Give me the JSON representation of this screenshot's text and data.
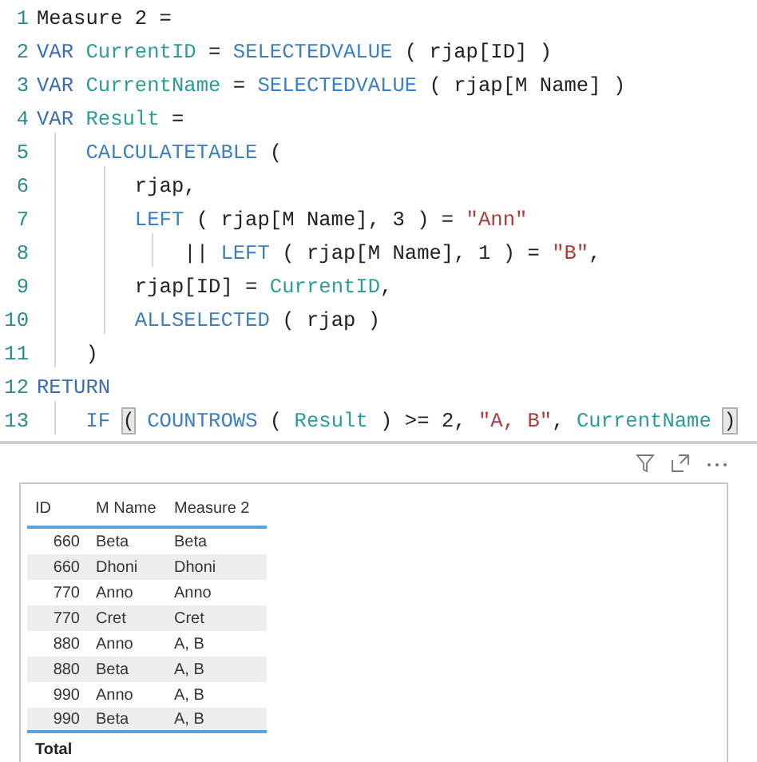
{
  "code_editor": {
    "lines": [
      {
        "number": "1",
        "tokens": [
          {
            "kind": "plain",
            "text": "Measure 2 ="
          }
        ]
      },
      {
        "number": "2",
        "tokens": [
          {
            "kind": "keyword",
            "text": "VAR "
          },
          {
            "kind": "variable",
            "text": "CurrentID"
          },
          {
            "kind": "plain",
            "text": " = "
          },
          {
            "kind": "function",
            "text": "SELECTEDVALUE"
          },
          {
            "kind": "plain",
            "text": " ( rjap[ID] )"
          }
        ]
      },
      {
        "number": "3",
        "tokens": [
          {
            "kind": "keyword",
            "text": "VAR "
          },
          {
            "kind": "variable",
            "text": "CurrentName"
          },
          {
            "kind": "plain",
            "text": " = "
          },
          {
            "kind": "function",
            "text": "SELECTEDVALUE"
          },
          {
            "kind": "plain",
            "text": " ( rjap[M Name] )"
          }
        ]
      },
      {
        "number": "4",
        "tokens": [
          {
            "kind": "keyword",
            "text": "VAR "
          },
          {
            "kind": "variable",
            "text": "Result"
          },
          {
            "kind": "plain",
            "text": " ="
          }
        ]
      },
      {
        "number": "5",
        "tokens": [
          {
            "kind": "function",
            "text": "    CALCULATETABLE"
          },
          {
            "kind": "plain",
            "text": " ("
          }
        ]
      },
      {
        "number": "6",
        "tokens": [
          {
            "kind": "plain",
            "text": "        rjap,"
          }
        ]
      },
      {
        "number": "7",
        "tokens": [
          {
            "kind": "function",
            "text": "        LEFT"
          },
          {
            "kind": "plain",
            "text": " ( rjap[M Name], 3 ) = "
          },
          {
            "kind": "string",
            "text": "\"Ann\""
          }
        ]
      },
      {
        "number": "8",
        "tokens": [
          {
            "kind": "plain",
            "text": "            || "
          },
          {
            "kind": "function",
            "text": "LEFT"
          },
          {
            "kind": "plain",
            "text": " ( rjap[M Name], 1 ) = "
          },
          {
            "kind": "string",
            "text": "\"B\""
          },
          {
            "kind": "plain",
            "text": ","
          }
        ]
      },
      {
        "number": "9",
        "tokens": [
          {
            "kind": "plain",
            "text": "        rjap[ID] = "
          },
          {
            "kind": "variable",
            "text": "CurrentID"
          },
          {
            "kind": "plain",
            "text": ","
          }
        ]
      },
      {
        "number": "10",
        "tokens": [
          {
            "kind": "function",
            "text": "        ALLSELECTED"
          },
          {
            "kind": "plain",
            "text": " ( rjap )"
          }
        ]
      },
      {
        "number": "11",
        "tokens": [
          {
            "kind": "plain",
            "text": "    )"
          }
        ]
      },
      {
        "number": "12",
        "tokens": [
          {
            "kind": "keyword",
            "text": "RETURN"
          }
        ]
      },
      {
        "number": "13",
        "tokens": [
          {
            "kind": "function",
            "text": "    IF "
          },
          {
            "kind": "bracket-match",
            "text": "("
          },
          {
            "kind": "function",
            "text": " COUNTROWS"
          },
          {
            "kind": "plain",
            "text": " ( "
          },
          {
            "kind": "variable",
            "text": "Result"
          },
          {
            "kind": "plain",
            "text": " ) >= 2, "
          },
          {
            "kind": "string",
            "text": "\"A, B\""
          },
          {
            "kind": "plain",
            "text": ", "
          },
          {
            "kind": "variable",
            "text": "CurrentName "
          },
          {
            "kind": "bracket-match",
            "text": ")"
          }
        ]
      }
    ]
  },
  "table": {
    "columns": [
      "ID",
      "M Name",
      "Measure 2"
    ],
    "rows": [
      [
        "660",
        "Beta",
        "Beta"
      ],
      [
        "660",
        "Dhoni",
        "Dhoni"
      ],
      [
        "770",
        "Anno",
        "Anno"
      ],
      [
        "770",
        "Cret",
        "Cret"
      ],
      [
        "880",
        "Anno",
        "A, B"
      ],
      [
        "880",
        "Beta",
        "A, B"
      ],
      [
        "990",
        "Anno",
        "A, B"
      ],
      [
        "990",
        "Beta",
        "A, B"
      ]
    ],
    "total_label": "Total"
  }
}
